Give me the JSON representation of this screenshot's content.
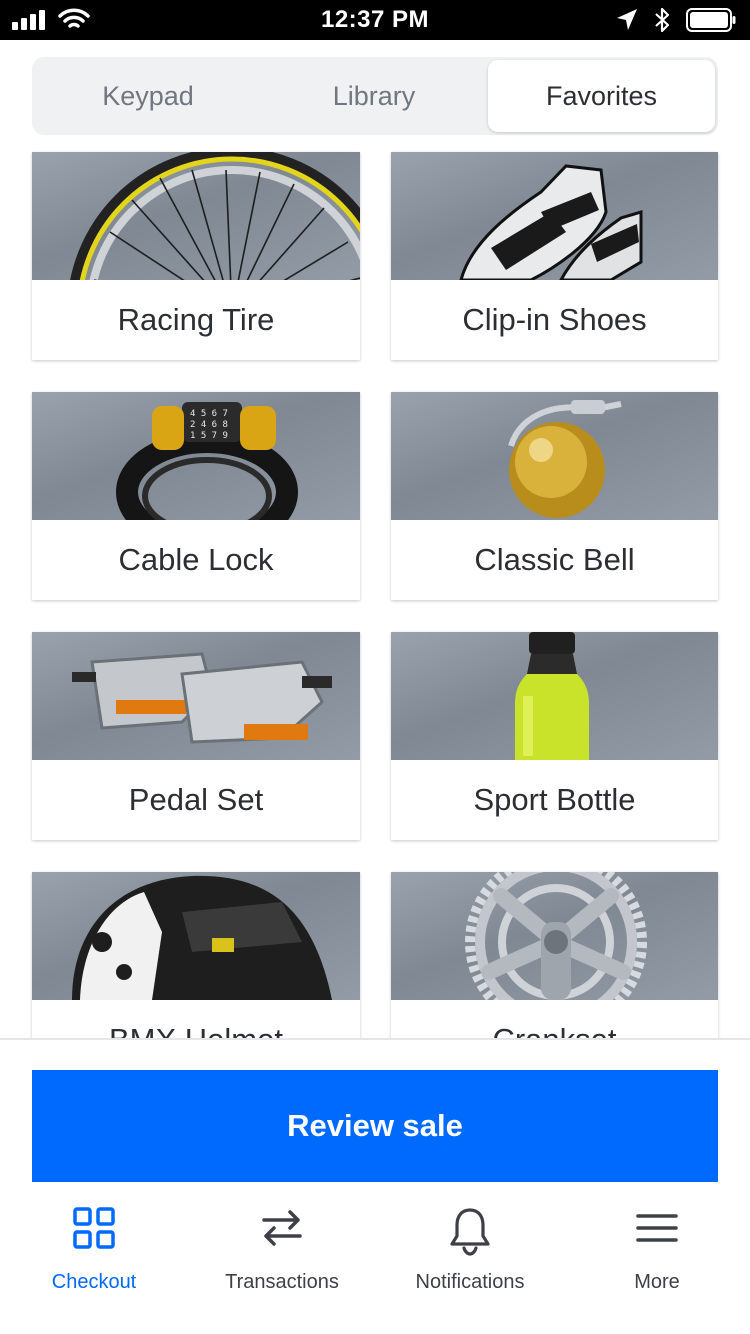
{
  "status_bar": {
    "time": "12:37 PM"
  },
  "segmented": {
    "tabs": [
      {
        "label": "Keypad",
        "selected": false
      },
      {
        "label": "Library",
        "selected": false
      },
      {
        "label": "Favorites",
        "selected": true
      }
    ]
  },
  "favorites": [
    {
      "label": "Racing Tire"
    },
    {
      "label": "Clip-in Shoes"
    },
    {
      "label": "Cable Lock"
    },
    {
      "label": "Classic Bell"
    },
    {
      "label": "Pedal Set"
    },
    {
      "label": "Sport Bottle"
    },
    {
      "label": "BMX Helmet"
    },
    {
      "label": "Crankset"
    }
  ],
  "review_button": {
    "label": "Review sale"
  },
  "tabbar": {
    "items": [
      {
        "label": "Checkout",
        "icon": "grid-icon",
        "active": true
      },
      {
        "label": "Transactions",
        "icon": "swap-arrows-icon",
        "active": false
      },
      {
        "label": "Notifications",
        "icon": "bell-icon",
        "active": false
      },
      {
        "label": "More",
        "icon": "menu-icon",
        "active": false
      }
    ]
  },
  "colors": {
    "accent": "#006aff",
    "text": "#2b2e33",
    "muted": "#717780",
    "segment_bg": "#f0f1f2"
  }
}
